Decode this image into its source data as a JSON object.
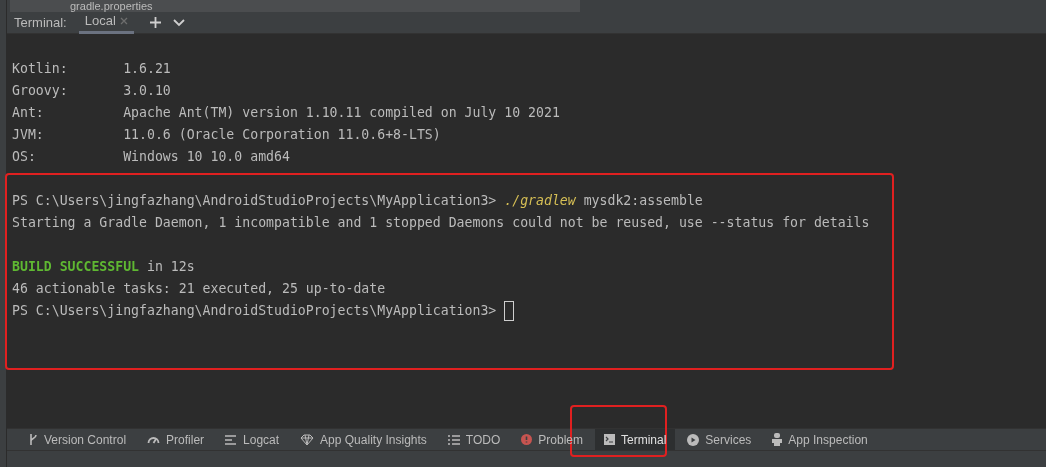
{
  "project_tree": {
    "file": "gradle.properties"
  },
  "terminal_tabs": {
    "label": "Terminal:",
    "tabs": [
      {
        "label": "Local",
        "selected": true
      }
    ]
  },
  "terminal_lines": [
    {
      "kind": "text",
      "segments": [
        {
          "text": "Kotlin:       1.6.21",
          "kind": "plain"
        }
      ]
    },
    {
      "kind": "text",
      "segments": [
        {
          "text": "Groovy:       3.0.10",
          "kind": "plain"
        }
      ]
    },
    {
      "kind": "text",
      "segments": [
        {
          "text": "Ant:          Apache Ant(TM) version 1.10.11 compiled on July 10 2021",
          "kind": "plain"
        }
      ]
    },
    {
      "kind": "text",
      "segments": [
        {
          "text": "JVM:          11.0.6 (Oracle Corporation 11.0.6+8-LTS)",
          "kind": "plain"
        }
      ]
    },
    {
      "kind": "text",
      "segments": [
        {
          "text": "OS:           Windows 10 10.0 amd64",
          "kind": "plain"
        }
      ]
    },
    {
      "kind": "blank"
    },
    {
      "kind": "text",
      "segments": [
        {
          "text": "PS C:\\Users\\jingfazhang\\AndroidStudioProjects\\MyApplication3> ",
          "kind": "plain"
        },
        {
          "text": "./gradlew",
          "kind": "command"
        },
        {
          "text": " mysdk2:assemble",
          "kind": "plain"
        }
      ]
    },
    {
      "kind": "text",
      "segments": [
        {
          "text": "Starting a Gradle Daemon, 1 incompatible and 1 stopped Daemons could not be reused, use --status for details",
          "kind": "plain"
        }
      ]
    },
    {
      "kind": "blank"
    },
    {
      "kind": "text",
      "segments": [
        {
          "text": "BUILD SUCCESSFUL",
          "kind": "success"
        },
        {
          "text": " in 12s",
          "kind": "plain"
        }
      ]
    },
    {
      "kind": "text",
      "segments": [
        {
          "text": "46 actionable tasks: 21 executed, 25 up-to-date",
          "kind": "plain"
        }
      ]
    },
    {
      "kind": "text",
      "segments": [
        {
          "text": "PS C:\\Users\\jingfazhang\\AndroidStudioProjects\\MyApplication3> ",
          "kind": "plain"
        }
      ],
      "cursor": true
    }
  ],
  "tool_tabs": [
    {
      "label": "Version Control",
      "selected": false
    },
    {
      "label": "Profiler",
      "selected": false
    },
    {
      "label": "Logcat",
      "selected": false
    },
    {
      "label": "App Quality Insights",
      "selected": false
    },
    {
      "label": "TODO",
      "selected": false
    },
    {
      "label": "Problem",
      "selected": false
    },
    {
      "label": "Terminal",
      "selected": true
    },
    {
      "label": "Services",
      "selected": false
    },
    {
      "label": "App Inspection",
      "selected": false
    }
  ]
}
